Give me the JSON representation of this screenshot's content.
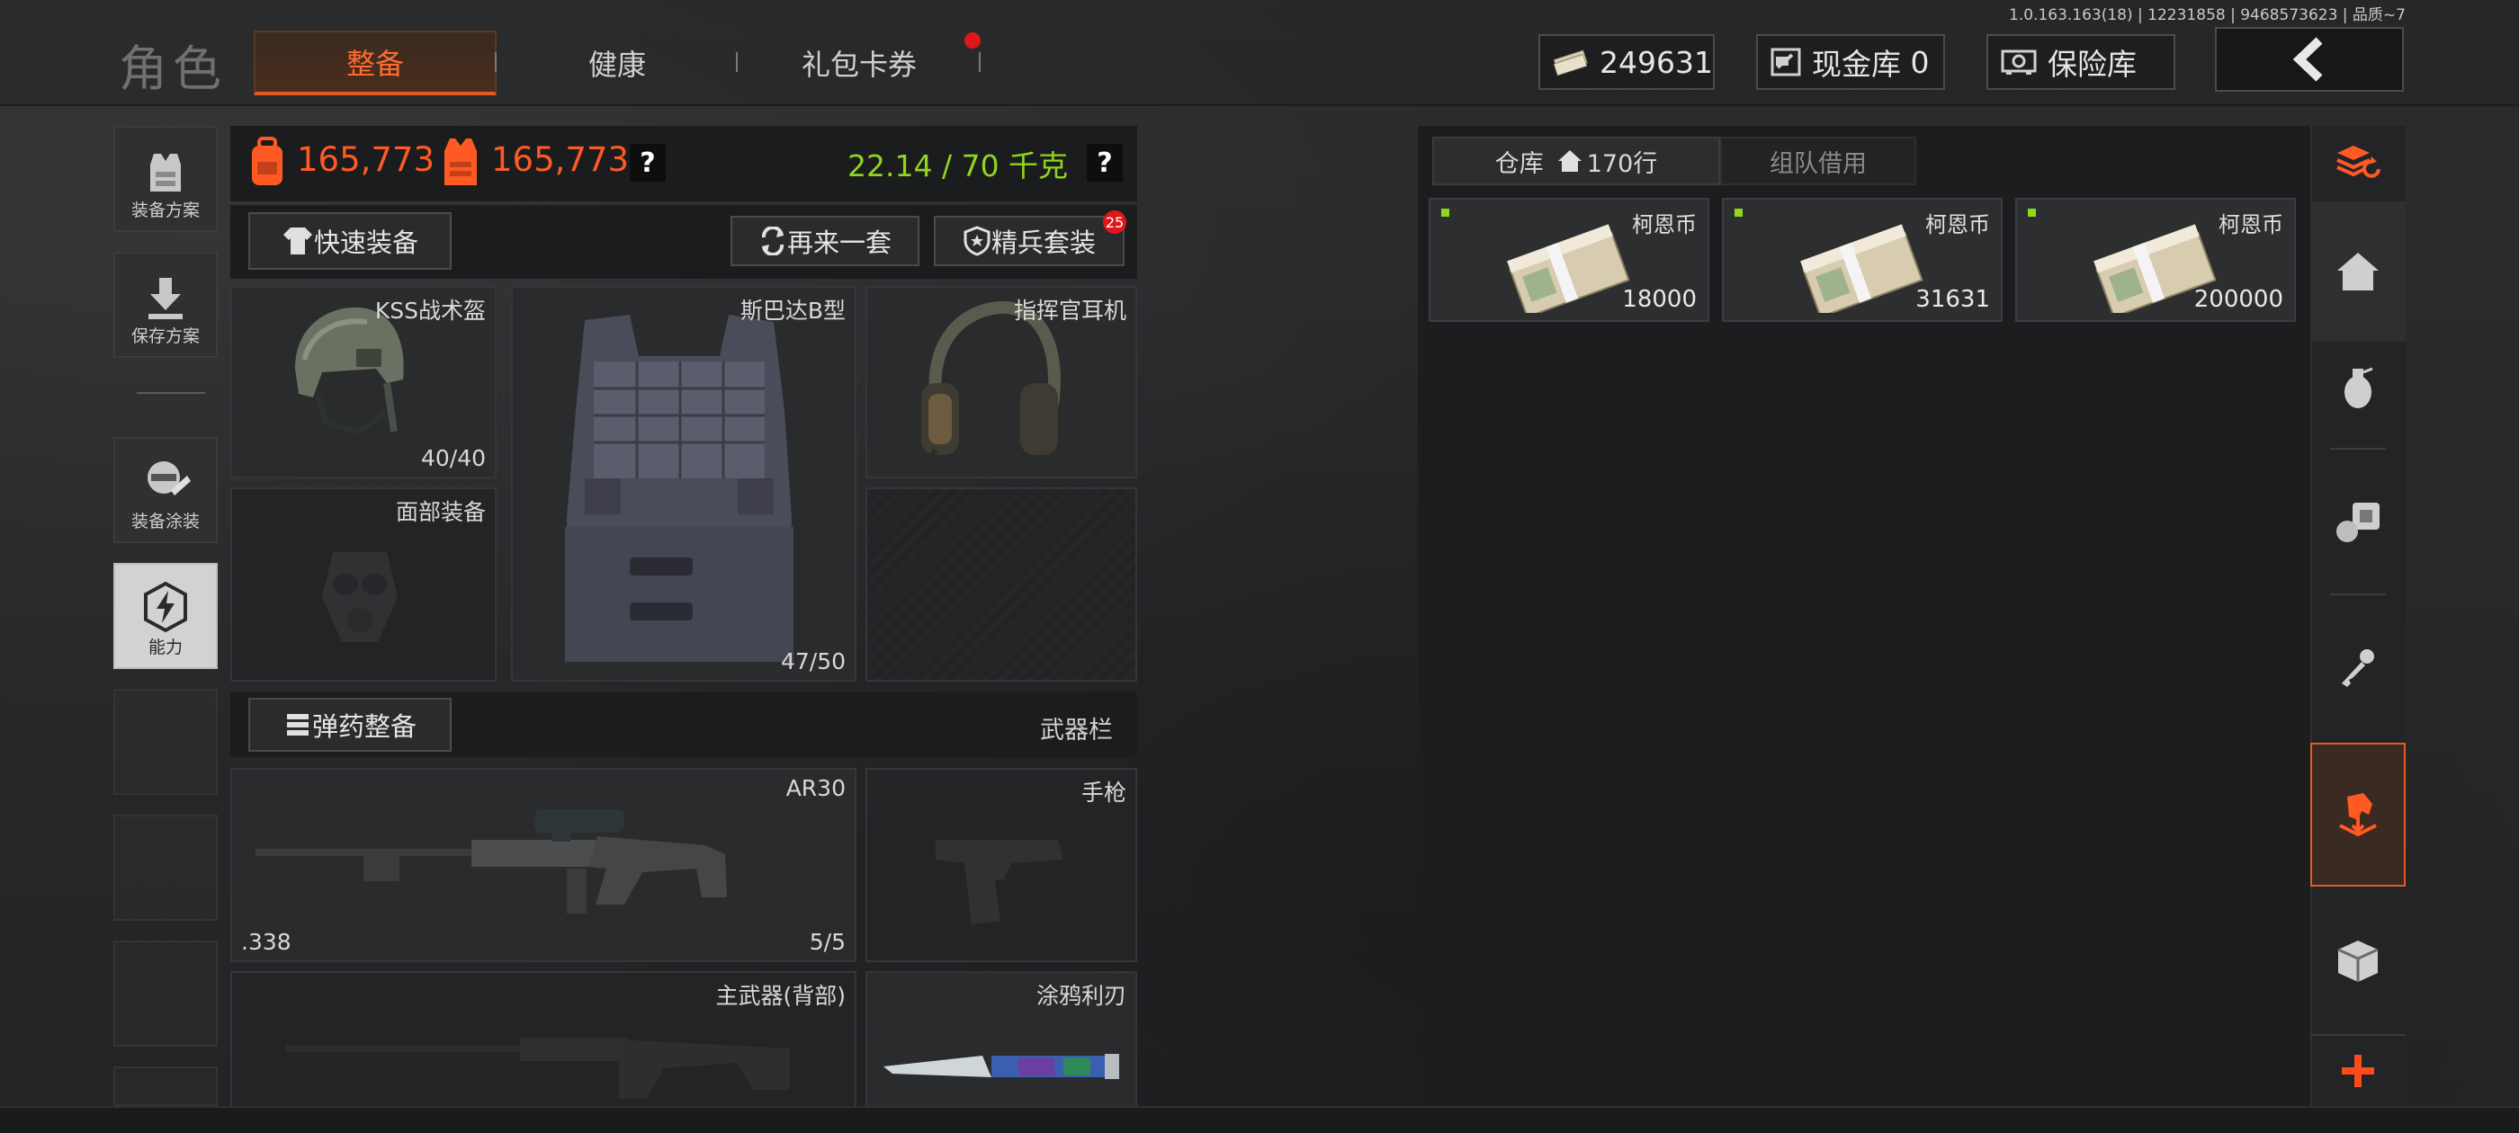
{
  "version_text": "1.0.163.163(18) | 12231858 | 9468573623 | 品质~7",
  "title": "角色",
  "tabs": [
    {
      "label": "整备",
      "active": true
    },
    {
      "label": "健康",
      "active": false
    },
    {
      "label": "礼包卡券",
      "active": false,
      "has_notification": true
    }
  ],
  "header": {
    "currency_value": "249631",
    "cash_vault_label": "现金库",
    "cash_vault_value": "0",
    "safe_label": "保险库"
  },
  "left_menu": [
    {
      "label": "装备方案"
    },
    {
      "label": "保存方案"
    },
    {
      "label": "装备涂装"
    },
    {
      "label": "能力"
    }
  ],
  "stats": {
    "value_a": "165,773",
    "value_b": "165,773",
    "weight": "22.14 / 70 千克",
    "help": "?"
  },
  "actions": {
    "quick_equip": "快速装备",
    "again": "再来一套",
    "elite_suit": "精兵套装",
    "elite_badge": "25",
    "ammo": "弹药整备",
    "weapon_bar": "武器栏"
  },
  "slots": {
    "helmet": {
      "label": "KSS战术盔",
      "durability": "40/40"
    },
    "armor": {
      "label": "斯巴达B型",
      "durability": "47/50"
    },
    "headset": {
      "label": "指挥官耳机"
    },
    "face": {
      "label": "面部装备"
    },
    "primary": {
      "label": "AR30",
      "caliber": ".338",
      "ammo": "5/5"
    },
    "pistol": {
      "label": "手枪"
    },
    "secondary": {
      "label": "主武器(背部)"
    },
    "melee": {
      "label": "涂鸦利刃"
    }
  },
  "warehouse": {
    "tab_label": "仓库",
    "rows": "170行",
    "team_tab": "组队借用",
    "items": [
      {
        "name": "柯恩币",
        "qty": "18000"
      },
      {
        "name": "柯恩币",
        "qty": "31631"
      },
      {
        "name": "柯恩币",
        "qty": "200000"
      }
    ]
  },
  "side_nav_icons": [
    "stack-refresh-icon",
    "home-icon",
    "grenade-icon",
    "consumables-icon",
    "key-icon",
    "horse-download-icon",
    "box-icon",
    "plus-icon"
  ],
  "colors": {
    "accent": "#ff5a24",
    "green": "#8fd61c",
    "notify": "#e0161a"
  }
}
